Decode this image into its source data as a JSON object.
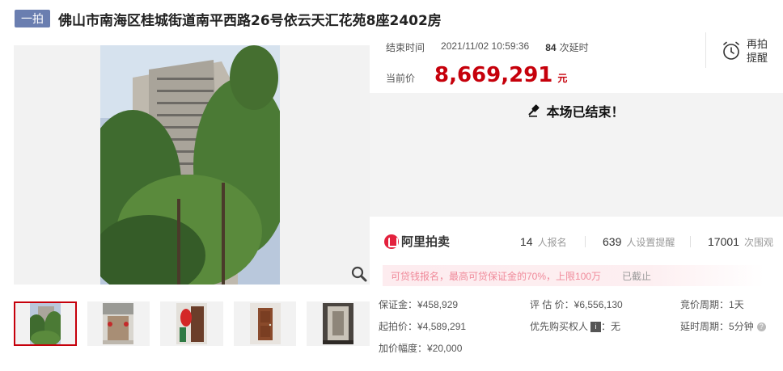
{
  "header": {
    "tag": "一拍",
    "title": "佛山市南海区桂城街道南平西路26号依云天汇花苑8座2402房"
  },
  "auction": {
    "end_label": "结束时间",
    "end_time": "2021/11/02 10:59:36",
    "delay_count": "84",
    "delay_label": "次延时",
    "price_label": "当前价",
    "price": "8,669,291",
    "price_unit": "元",
    "remind_label": "再拍提醒",
    "ended_text": "本场已结束！"
  },
  "stats": {
    "brand": "阿里拍卖",
    "signups": "14",
    "signups_label": "人报名",
    "reminders": "639",
    "reminders_label": "人设置提醒",
    "views": "17001",
    "views_label": "次围观"
  },
  "notice": {
    "text": "可贷钱报名，最高可贷保证金的70%，上限100万",
    "status": "已截止"
  },
  "details": {
    "deposit_label": "保证金：",
    "deposit": "¥458,929",
    "appraisal_label": "评 估 价：",
    "appraisal": "¥6,556,130",
    "cycle_label": "竞价周期：",
    "cycle": "1天",
    "start_label": "起拍价：",
    "start": "¥4,589,291",
    "priority_label": "优先购买权人",
    "priority_badge": "i",
    "priority_value": "：无",
    "delay_label": "延时周期：",
    "delay": "5分钟",
    "increment_label": "加价幅度：",
    "increment": "¥20,000"
  },
  "colors": {
    "accent": "#c6000b",
    "tag": "#6a7eb0",
    "brand": "#e3213d"
  },
  "icons": {
    "zoom": "magnifier-icon",
    "remind": "alarm-clock-icon",
    "ended": "gavel-icon"
  }
}
